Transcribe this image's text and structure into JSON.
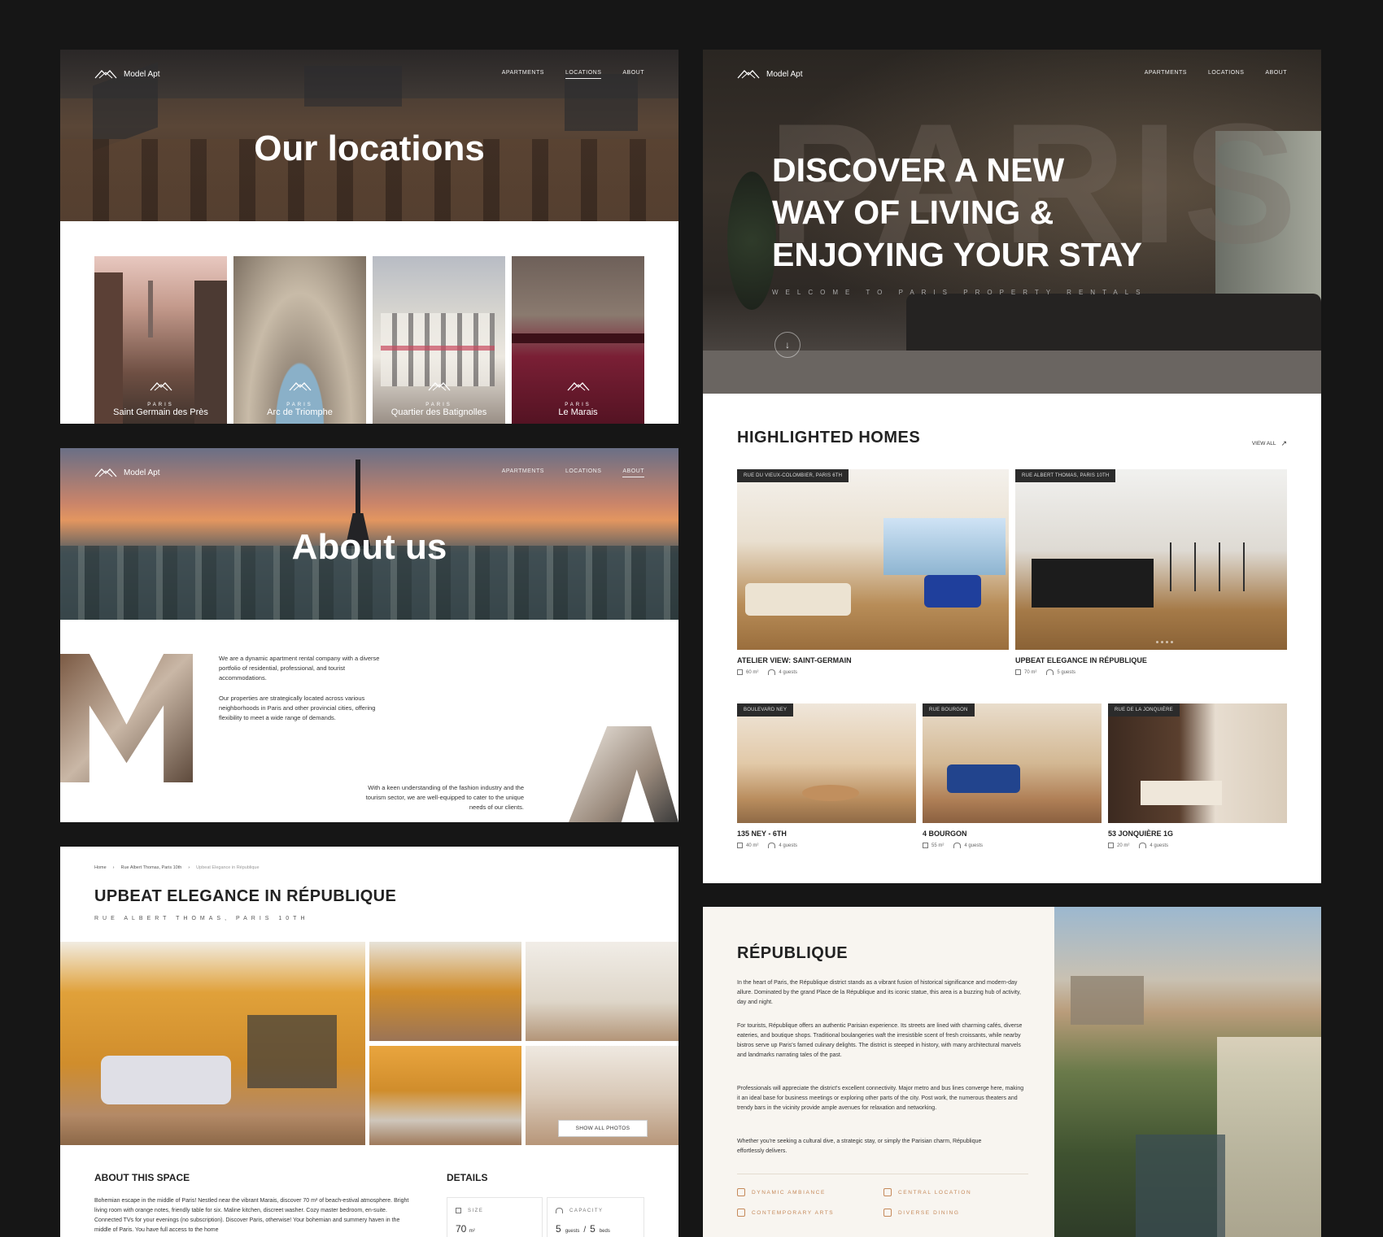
{
  "brand": {
    "name": "Model Apt"
  },
  "nav": {
    "apartments": "APARTMENTS",
    "locations": "LOCATIONS",
    "about": "ABOUT"
  },
  "locations_page": {
    "title": "Our locations",
    "cards": [
      {
        "city": "PARIS",
        "name": "Saint Germain des Près"
      },
      {
        "city": "PARIS",
        "name": "Arc de Triomphe"
      },
      {
        "city": "PARIS",
        "name": "Quartier des Batignolles"
      },
      {
        "city": "PARIS",
        "name": "Le Marais"
      }
    ]
  },
  "about_page": {
    "title": "About us",
    "para1": "We are a dynamic apartment rental company with a diverse portfolio of residential, professional, and tourist accommodations.",
    "para2": "Our properties are strategically located across various neighborhoods in Paris and other provincial cities, offering flexibility to meet a wide range of demands.",
    "para3": "With a keen understanding of the fashion industry and the tourism sector, we are well-equipped to cater to the unique needs of our clients.",
    "letter_m": "M",
    "letter_a": "A"
  },
  "home_page": {
    "bg_word": "PARIS",
    "headline_1": "DISCOVER A NEW",
    "headline_2": "WAY OF LIVING &",
    "headline_3": "ENJOYING YOUR STAY",
    "subtitle": "WELCOME TO PARIS PROPERTY RENTALS",
    "scroll_icon": "arrow-down-icon",
    "section_title": "HIGHLIGHTED HOMES",
    "view_all": "VIEW ALL",
    "homes": [
      {
        "tag": "RUE DU VIEUX-COLOMBIER, PARIS 6TH",
        "title": "ATELIER VIEW: SAINT-GERMAIN",
        "size": "60 m²",
        "guests": "4 guests"
      },
      {
        "tag": "RUE ALBERT THOMAS, PARIS 10TH",
        "title": "UPBEAT ELEGANCE IN RÉPUBLIQUE",
        "size": "70 m²",
        "guests": "5 guests"
      },
      {
        "tag": "BOULEVARD NEY",
        "title": "135 NEY - 6TH",
        "size": "40 m²",
        "guests": "4 guests"
      },
      {
        "tag": "RUE BOURGON",
        "title": "4 BOURGON",
        "size": "55 m²",
        "guests": "4 guests"
      },
      {
        "tag": "RUE DE LA JONQUIÈRE",
        "title": "53 JONQUIÈRE 1G",
        "size": "20 m²",
        "guests": "4 guests"
      }
    ]
  },
  "detail_page": {
    "breadcrumb": [
      "Home",
      "Rue Albert Thomas, Paris 10th",
      "Upbeat Elegance in République"
    ],
    "title": "UPBEAT ELEGANCE IN RÉPUBLIQUE",
    "subtitle": "RUE ALBERT THOMAS, PARIS 10TH",
    "show_all": "SHOW ALL PHOTOS",
    "about_heading": "ABOUT THIS SPACE",
    "about_text": "Bohemian escape in the middle of Paris! Nestled near the vibrant Marais, discover 70 m² of beach-estival atmosphere. Bright living room with orange notes, friendly table for six. Maline kitchen, discreet washer. Cozy master bedroom, en-suite. Connected TVs for your evenings (no subscription). Discover Paris, otherwise! Your bohemian and summery haven in the middle of Paris. You have full access to the home",
    "details_heading": "DETAILS",
    "size_label": "SIZE",
    "size_value": "70",
    "size_unit": "m²",
    "capacity_label": "CAPACITY",
    "guests_value": "5",
    "guests_unit": "guests",
    "beds_value": "5",
    "beds_unit": "beds"
  },
  "district_page": {
    "title": "RÉPUBLIQUE",
    "p1": "In the heart of Paris, the République district stands as a vibrant fusion of historical significance and modern-day allure. Dominated by the grand Place de la République and its iconic statue, this area is a buzzing hub of activity, day and night.",
    "p2": "For tourists, République offers an authentic Parisian experience. Its streets are lined with charming cafés, diverse eateries, and boutique shops. Traditional boulangeries waft the irresistible scent of fresh croissants, while nearby bistros serve up Paris's famed culinary delights. The district is steeped in history, with many architectural marvels and landmarks narrating tales of the past.",
    "p3": "Professionals will appreciate the district's excellent connectivity. Major metro and bus lines converge here, making it an ideal base for business meetings or exploring other parts of the city. Post work, the numerous theaters and trendy bars in the vicinity provide ample avenues for relaxation and networking.",
    "p4": "Whether you're seeking a cultural dive, a strategic stay, or simply the Parisian charm, République effortlessly delivers.",
    "features": [
      "DYNAMIC AMBIANCE",
      "CENTRAL LOCATION",
      "CONTEMPORARY ARTS",
      "DIVERSE DINING"
    ]
  }
}
